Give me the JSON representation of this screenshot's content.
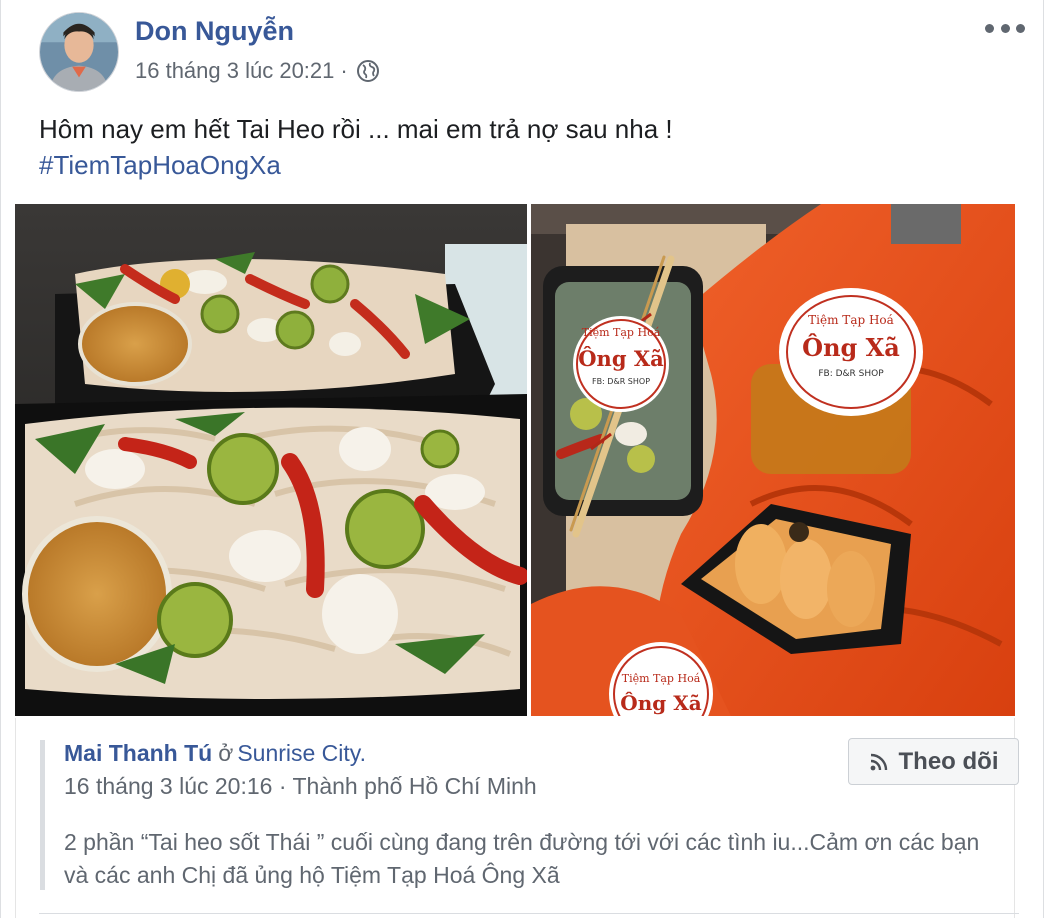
{
  "post": {
    "author": "Don Nguyễn",
    "timestamp": "16 tháng 3 lúc 20:21",
    "separator": "·",
    "privacy_icon": "globe-icon",
    "text": "Hôm nay em hết Tai Heo rồi ... mai em trả nợ sau nha !",
    "hashtag": "#TiemTapHoaOngXa",
    "more_icon": "more-options-icon"
  },
  "photos": {
    "left_alt": "food-photo-pork-ear-salad",
    "right_alt": "food-photo-packaged-orders",
    "label_line1": "Tiệm Tạp Hoá",
    "label_line2": "Ông Xã",
    "label_line3": "FB: D&R SHOP"
  },
  "shared": {
    "name": "Mai Thanh Tú",
    "at": "ở",
    "place": "Sunrise City.",
    "timestamp": "16 tháng 3 lúc 20:16 · Thành phố Hồ Chí Minh",
    "body": "2 phần “Tai heo sốt Thái ” cuối cùng đang trên đường tới với các tình iu...Cảm ơn các bạn và các anh Chị đã ủng hộ Tiệm Tạp Hoá Ông Xã",
    "follow_label": "Theo dõi",
    "follow_icon": "rss-icon"
  },
  "colors": {
    "link": "#385898",
    "secondary_text": "#606770",
    "accent_orange": "#e8501c"
  }
}
